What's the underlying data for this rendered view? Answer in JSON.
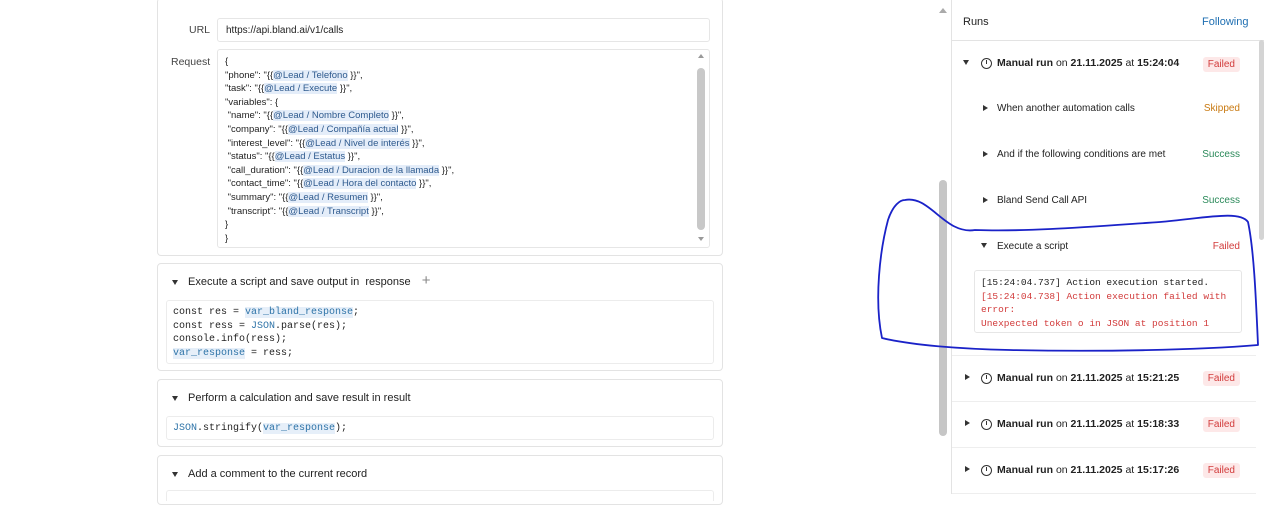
{
  "left": {
    "url_label": "URL",
    "url_value": "https://api.bland.ai/v1/calls",
    "request_label": "Request",
    "request_lines": [
      {
        "pre": "{",
        "tag": "",
        "post": ""
      },
      {
        "pre": "\"phone\": \"{{",
        "tag": "@Lead / Telefono",
        "post": " }}\","
      },
      {
        "pre": "\"task\": \"{{",
        "tag": "@Lead / Execute",
        "post": " }}\","
      },
      {
        "pre": "\"variables\": {",
        "tag": "",
        "post": ""
      },
      {
        "pre": " \"name\": \"{{",
        "tag": "@Lead / Nombre Completo",
        "post": " }}\","
      },
      {
        "pre": " \"company\": \"{{",
        "tag": "@Lead / Compañía actual",
        "post": " }}\","
      },
      {
        "pre": " \"interest_level\": \"{{",
        "tag": "@Lead / Nivel de interés",
        "post": " }}\","
      },
      {
        "pre": " \"status\": \"{{",
        "tag": "@Lead / Estatus",
        "post": " }}\","
      },
      {
        "pre": " \"call_duration\": \"{{",
        "tag": "@Lead / Duracion de la llamada",
        "post": " }}\","
      },
      {
        "pre": " \"contact_time\": \"{{",
        "tag": "@Lead / Hora del contacto",
        "post": " }}\","
      },
      {
        "pre": " \"summary\": \"{{",
        "tag": "@Lead / Resumen",
        "post": " }}\","
      },
      {
        "pre": " \"transcript\": \"{{",
        "tag": "@Lead / Transcript",
        "post": " }}\","
      },
      {
        "pre": "}",
        "tag": "",
        "post": ""
      },
      {
        "pre": "}",
        "tag": "",
        "post": ""
      }
    ],
    "script_title": "Execute a script",
    "script_suffix": "and save output in",
    "script_output": "response",
    "script_lines": [
      [
        "const res = ",
        "var_bland_response",
        ";"
      ],
      [
        "const ress = ",
        "JSON",
        ".parse(res);"
      ],
      [
        "console.info(ress);",
        "",
        ""
      ],
      [
        "",
        "var_response",
        " = ress;"
      ]
    ],
    "calc_title": "Perform a calculation",
    "calc_suffix": "and save result in result",
    "calc_code_fn": "JSON",
    "calc_code_mid": ".stringify(",
    "calc_code_var": "var_response",
    "calc_code_end": ");",
    "comment_title": "Add a comment to the current record"
  },
  "right": {
    "title": "Runs",
    "following": "Following",
    "runs": [
      {
        "label": "Manual run",
        "on": "on",
        "date": "21.11.2025",
        "at": "at",
        "time": "15:24:04",
        "status": "Failed"
      },
      {
        "label": "Manual run",
        "on": "on",
        "date": "21.11.2025",
        "at": "at",
        "time": "15:21:25",
        "status": "Failed"
      },
      {
        "label": "Manual run",
        "on": "on",
        "date": "21.11.2025",
        "at": "at",
        "time": "15:18:33",
        "status": "Failed"
      },
      {
        "label": "Manual run",
        "on": "on",
        "date": "21.11.2025",
        "at": "at",
        "time": "15:17:26",
        "status": "Failed"
      }
    ],
    "steps": [
      {
        "label": "When another automation calls",
        "status": "Skipped"
      },
      {
        "label": "And if the following conditions are met",
        "status": "Success"
      },
      {
        "label": "Bland Send Call API",
        "status": "Success"
      },
      {
        "label": "Execute a script",
        "status": "Failed"
      }
    ],
    "log": [
      "[15:24:04.737] Action execution started.",
      "[15:24:04.738] Action execution failed with",
      "error:",
      "Unexpected token o in JSON at position 1"
    ]
  },
  "colors": {
    "annotation": "#1a22c8",
    "failed": "#d23b3b",
    "success": "#2b8a5a",
    "skipped": "#c97a12",
    "link": "#1f6fb2"
  }
}
